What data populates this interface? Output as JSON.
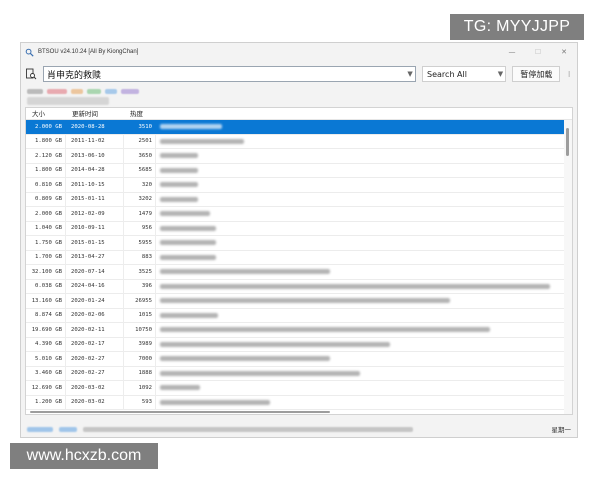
{
  "watermarks": {
    "top": "TG: MYYJJPP",
    "bottom": "www.hcxzb.com"
  },
  "window": {
    "title": "BTSOU v24.10.24 [All By KiongChan]",
    "controls": [
      "—",
      "☐",
      "✕"
    ]
  },
  "toolbar": {
    "search_value": "肖申克的救赎",
    "scope_value": "Search All",
    "pause_label": "暂停加载",
    "more_label": "⁝"
  },
  "colors": {
    "accent": "#0a78d4",
    "tag_red": "#e0707a",
    "tag_orange": "#e8a25a",
    "tag_green": "#6fbf7a",
    "tag_blue": "#6aa8e4",
    "tag_purple": "#9b7fd1",
    "tag_gray": "#8e8e8e"
  },
  "table": {
    "headers": {
      "size": "大小",
      "date": "更新时间",
      "heat": "热度"
    },
    "rows": [
      {
        "size": "2.000 GB",
        "date": "2020-08-28",
        "heat": "3510",
        "selected": true
      },
      {
        "size": "1.800 GB",
        "date": "2011-11-02",
        "heat": "2501"
      },
      {
        "size": "2.120 GB",
        "date": "2013-06-10",
        "heat": "3650"
      },
      {
        "size": "1.800 GB",
        "date": "2014-04-28",
        "heat": "5685"
      },
      {
        "size": "0.810 GB",
        "date": "2011-10-15",
        "heat": "320"
      },
      {
        "size": "0.809 GB",
        "date": "2015-01-11",
        "heat": "3202"
      },
      {
        "size": "2.000 GB",
        "date": "2012-02-09",
        "heat": "1479"
      },
      {
        "size": "1.040 GB",
        "date": "2010-09-11",
        "heat": "956"
      },
      {
        "size": "1.750 GB",
        "date": "2015-01-15",
        "heat": "5955"
      },
      {
        "size": "1.700 GB",
        "date": "2013-04-27",
        "heat": "883"
      },
      {
        "size": "32.100 GB",
        "date": "2020-07-14",
        "heat": "3525"
      },
      {
        "size": "0.038 GB",
        "date": "2024-04-16",
        "heat": "396"
      },
      {
        "size": "13.160 GB",
        "date": "2020-01-24",
        "heat": "26955"
      },
      {
        "size": "8.874 GB",
        "date": "2020-02-06",
        "heat": "1015"
      },
      {
        "size": "19.690 GB",
        "date": "2020-02-11",
        "heat": "10750"
      },
      {
        "size": "4.390 GB",
        "date": "2020-02-17",
        "heat": "3989"
      },
      {
        "size": "5.010 GB",
        "date": "2020-02-27",
        "heat": "7000"
      },
      {
        "size": "3.460 GB",
        "date": "2020-02-27",
        "heat": "1888"
      },
      {
        "size": "12.690 GB",
        "date": "2020-03-02",
        "heat": "1092"
      },
      {
        "size": "1.200 GB",
        "date": "2020-03-02",
        "heat": "593"
      }
    ]
  },
  "statusbar": {
    "day_label": "星期一"
  }
}
